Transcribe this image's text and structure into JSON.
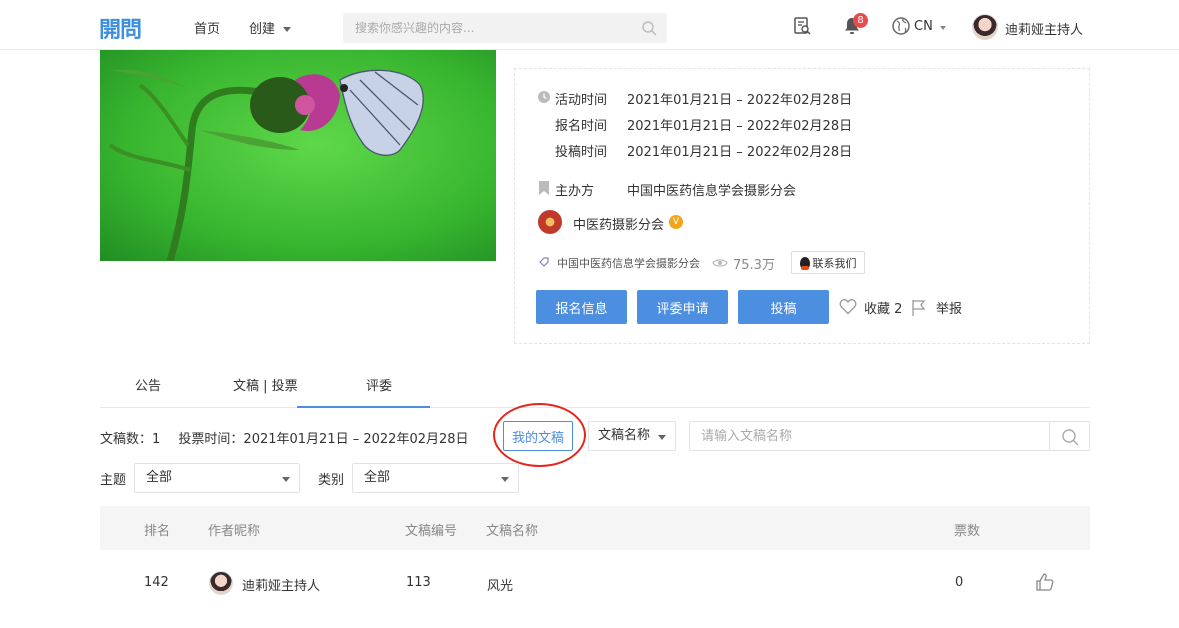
{
  "header": {
    "logo": "開問",
    "nav_home": "首页",
    "nav_create": "创建",
    "search_placeholder": "搜索你感兴趣的内容...",
    "notification_count": "8",
    "language": "CN",
    "username": "迪莉娅主持人"
  },
  "activity": {
    "title": "",
    "activity_time_label": "活动时间",
    "activity_time": "2021年01月21日 – 2022年02月28日",
    "signup_time_label": "报名时间",
    "signup_time": "2021年01月21日 – 2022年02月28日",
    "submit_time_label": "投稿时间",
    "submit_time": "2021年01月21日 – 2022年02月28日",
    "organizer_label": "主办方",
    "organizer": "中国中医药信息学会摄影分会",
    "org_account": "中医药摄影分会",
    "tag_org": "中国中医药信息学会摄影分会",
    "views": "75.3万",
    "contact": "联系我们",
    "btn_signup_info": "报名信息",
    "btn_judge_apply": "评委申请",
    "btn_submit": "投稿",
    "favorite": "收藏 2",
    "report": "举报"
  },
  "tabs": [
    {
      "label": "公告"
    },
    {
      "label": "文稿 | 投票"
    },
    {
      "label": "评委"
    }
  ],
  "filters": {
    "submission_count": "文稿数：1",
    "vote_time": "投票时间：2021年01月21日 – 2022年02月28日",
    "my_submissions": "我的文稿",
    "search_field": "文稿名称",
    "search_placeholder": "请输入文稿名称",
    "theme_label": "主题",
    "theme_value": "全部",
    "category_label": "类别",
    "category_value": "全部"
  },
  "table": {
    "columns": [
      "排名",
      "作者昵称",
      "文稿编号",
      "文稿名称",
      "票数"
    ],
    "rows": [
      {
        "rank": "142",
        "author": "迪莉娅主持人",
        "number": "113",
        "name": "风光",
        "votes": "0"
      }
    ]
  },
  "colors": {
    "accent": "#4c8ee0",
    "highlight": "#e5261c",
    "badge": "#e84b4b"
  }
}
